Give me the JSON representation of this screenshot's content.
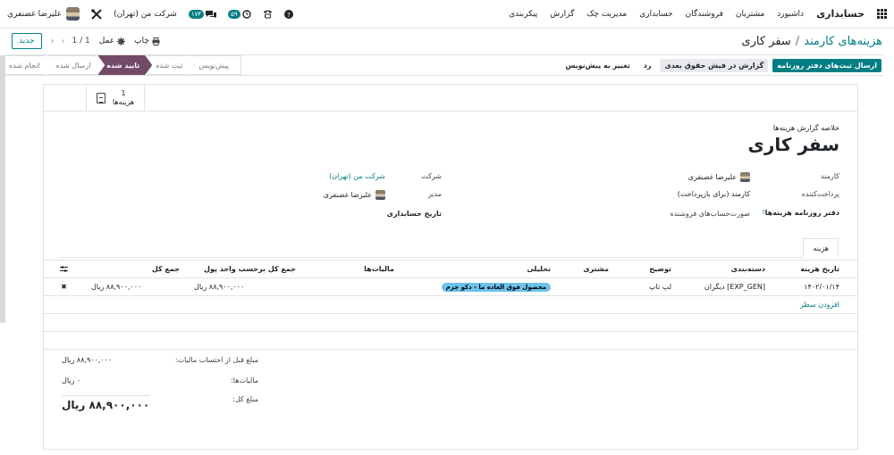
{
  "topbar": {
    "brand": "حسابداری",
    "menu": [
      "داشبورد",
      "مشتریان",
      "فروشندگان",
      "حسابداری",
      "مدیریت چک",
      "گزارش",
      "پیکربندی"
    ],
    "user_name": "علیرضا غضنفری",
    "company": "شرکت من (تهران)",
    "activity_badge": "۵۹",
    "messages_badge": "۱۷۴",
    "icons": [
      "apps-grid-icon",
      "help-icon",
      "phone-icon",
      "clock-icon",
      "chat-icon",
      "tools-icon"
    ]
  },
  "control": {
    "breadcrumb_parent": "هزینه‌های کارمند",
    "breadcrumb_sep": "/",
    "breadcrumb_current": "سفر کاری",
    "new_button": "جدید",
    "pager": "1 / 1",
    "print": "چاپ",
    "action": "عمل"
  },
  "header": {
    "buttons": {
      "post_entries": "ارسال ثبت‌های دفتر روزنامه",
      "report_payslip": "گزارش در فیش حقوق بعدی",
      "refuse": "رد",
      "reset_draft": "تغییر به پیش‌نویس"
    },
    "stages": [
      "پیش‌نویس",
      "ثبت شده",
      "تایید شده",
      "ارسال شده",
      "انجام شده"
    ],
    "active_stage": "تایید شده"
  },
  "smart_button": {
    "count": "1",
    "label": "هزینه‌ها"
  },
  "form": {
    "subtitle": "خلاصه گزارش هزینه‌ها",
    "title": "سفر کاری",
    "left": {
      "employee_label": "کارمند",
      "employee_value": "علیرضا غضنفری",
      "payer_label": "پرداخت‌کننده",
      "payer_value": "کارمند (برای بازپرداخت)",
      "journal_label": "دفتر روزنامه هزینه‌ها",
      "journal_help": "؟",
      "vendor_bill_label": "صورت‌حساب‌های فروشنده"
    },
    "right": {
      "company_label": "شرکت",
      "company_value": "شرکت من (تهران)",
      "manager_label": "مدیر",
      "manager_value": "علیرضا غضنفری",
      "accounting_date_label": "تاریخ حسابداری"
    }
  },
  "tab": "هزینه",
  "table": {
    "headers": [
      "تاریخ هزینه",
      "دسته‌بندی",
      "توضیح",
      "مشتری",
      "تحلیلی",
      "مالیات‌ها",
      "جمع کل برحسب واحد پول",
      "جمع کل"
    ],
    "rows": [
      {
        "date": "۱۴۰۲/۰۱/۱۴",
        "category": "[EXP_GEN] دیگران",
        "description": "لپ تاپ",
        "customer": "",
        "analytic": "محصول فوق العاده ما - دکو چرم",
        "taxes": "",
        "total_currency": "۸۸,۹۰۰,۰۰۰ ریال",
        "total": "۸۸,۹۰۰,۰۰۰ ریال"
      }
    ],
    "add_line": "افزودن سطر"
  },
  "totals": {
    "untaxed_label": "مبلغ قبل از احتساب مالیات:",
    "untaxed_value": "۸۸,۹۰۰,۰۰۰ ریال",
    "taxes_label": "مالیات‌ها:",
    "taxes_value": "۰ ریال",
    "total_label": "مبلغ کل:",
    "total_value": "۸۸,۹۰۰,۰۰۰ ریال"
  },
  "colors": {
    "primary": "#017e84",
    "stage_active": "#714b67",
    "tag": "#6cc1ed"
  }
}
